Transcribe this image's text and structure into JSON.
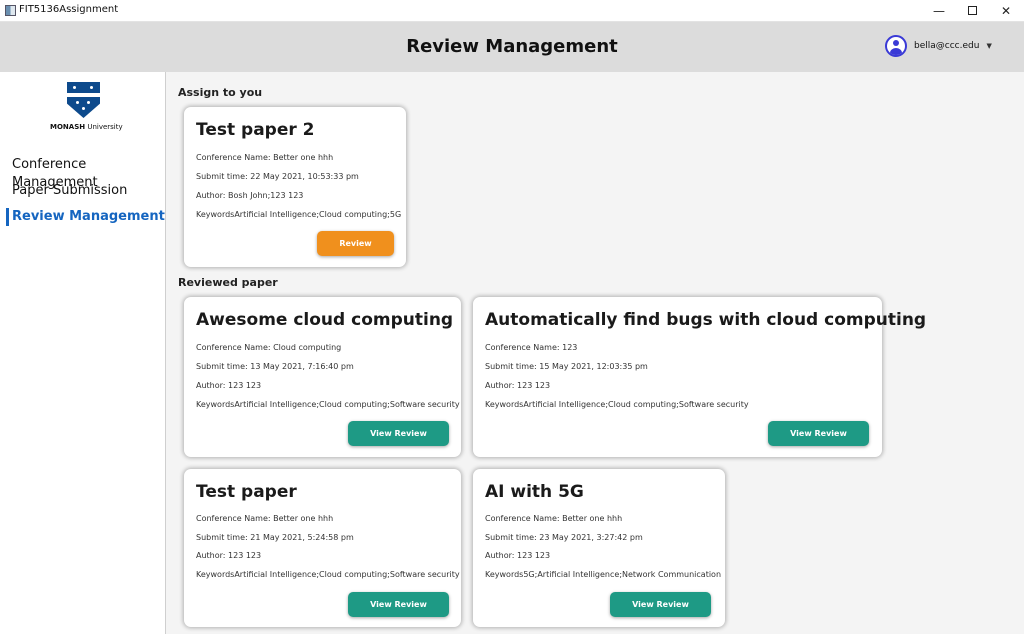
{
  "window": {
    "title": "FIT5136Assignment",
    "minimize": "—",
    "close": "✕"
  },
  "header": {
    "title": "Review Management",
    "user_email": "bella@ccc.edu",
    "caret": "▼"
  },
  "logo": {
    "text_bold": "MONASH",
    "text_light": " University"
  },
  "sidebar": {
    "items": [
      {
        "label": "Conference Management",
        "active": false
      },
      {
        "label": "Paper Submission",
        "active": false
      },
      {
        "label": "Review Management",
        "active": true
      }
    ]
  },
  "sections": {
    "assigned": "Assign to you",
    "reviewed": "Reviewed paper"
  },
  "assigned_papers": [
    {
      "title": "Test paper 2",
      "conference": "Conference Name: Better one hhh",
      "submit_time": "Submit time: 22 May 2021, 10:53:33 pm",
      "author": "Author: Bosh John;123 123",
      "keywords": "KeywordsArtificial Intelligence;Cloud computing;5G",
      "button": "Review"
    }
  ],
  "reviewed_papers": [
    {
      "title": "Awesome cloud computing",
      "conference": "Conference Name: Cloud computing",
      "submit_time": "Submit time: 13 May 2021, 7:16:40 pm",
      "author": "Author: 123 123",
      "keywords": "KeywordsArtificial Intelligence;Cloud computing;Software security",
      "button": "View Review"
    },
    {
      "title": "Automatically find bugs with cloud computing",
      "conference": "Conference Name: 123",
      "submit_time": "Submit time: 15 May 2021, 12:03:35 pm",
      "author": "Author: 123 123",
      "keywords": "KeywordsArtificial Intelligence;Cloud computing;Software security",
      "button": "View Review"
    },
    {
      "title": "Test paper",
      "conference": "Conference Name: Better one hhh",
      "submit_time": "Submit time: 21 May 2021, 5:24:58 pm",
      "author": "Author: 123 123",
      "keywords": "KeywordsArtificial Intelligence;Cloud computing;Software security",
      "button": "View Review"
    },
    {
      "title": "AI with 5G",
      "conference": "Conference Name: Better one hhh",
      "submit_time": "Submit time: 23 May 2021, 3:27:42 pm",
      "author": "Author: 123 123",
      "keywords": "Keywords5G;Artificial Intelligence;Network Communication",
      "button": "View Review"
    }
  ],
  "colors": {
    "accent": "#1565c0",
    "review_button": "#f0901d",
    "view_button": "#1e9a85",
    "header_bg": "#dcdcdc",
    "avatar": "#3a3ad6"
  }
}
